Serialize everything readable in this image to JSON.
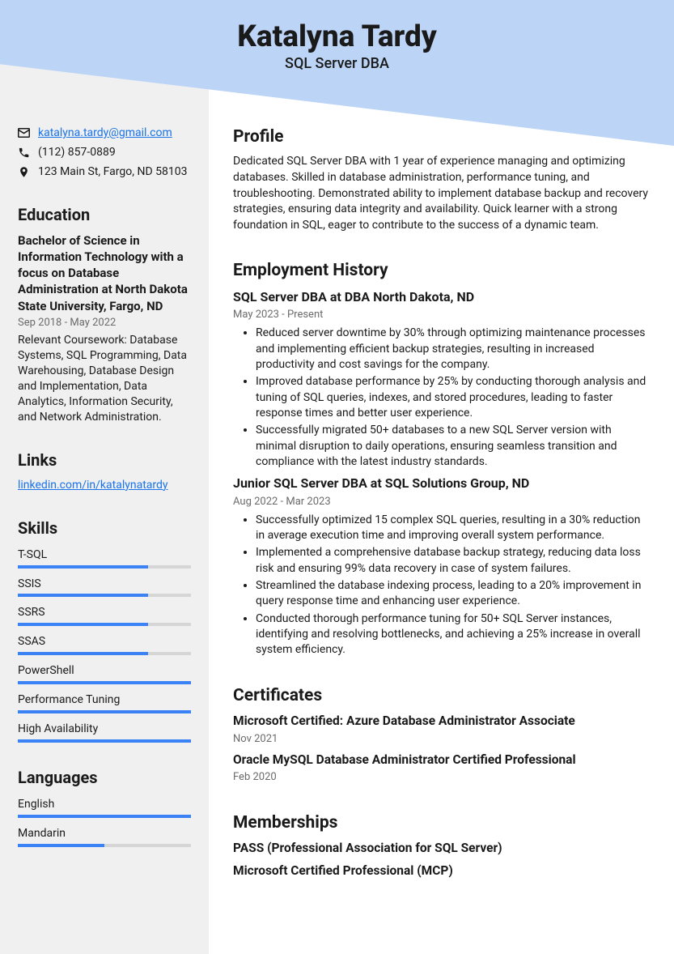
{
  "header": {
    "name": "Katalyna Tardy",
    "title": "SQL Server DBA"
  },
  "contact": {
    "email": "katalyna.tardy@gmail.com",
    "phone": "(112) 857-0889",
    "address": "123 Main St, Fargo, ND 58103"
  },
  "education": {
    "heading": "Education",
    "degree": "Bachelor of Science in Information Technology with a focus on Database Administration at North Dakota State University, Fargo, ND",
    "dates": "Sep 2018 - May 2022",
    "courses": "Relevant Coursework: Database Systems, SQL Programming, Data Warehousing, Database Design and Implementation, Data Analytics, Information Security, and Network Administration."
  },
  "links": {
    "heading": "Links",
    "items": [
      "linkedin.com/in/katalynatardy"
    ]
  },
  "skills": {
    "heading": "Skills",
    "items": [
      {
        "name": "T-SQL",
        "pct": 75
      },
      {
        "name": "SSIS",
        "pct": 75
      },
      {
        "name": "SSRS",
        "pct": 75
      },
      {
        "name": "SSAS",
        "pct": 75
      },
      {
        "name": "PowerShell",
        "pct": 100
      },
      {
        "name": "Performance Tuning",
        "pct": 100
      },
      {
        "name": "High Availability",
        "pct": 100
      }
    ]
  },
  "languages": {
    "heading": "Languages",
    "items": [
      {
        "name": "English",
        "pct": 100
      },
      {
        "name": "Mandarin",
        "pct": 50
      }
    ]
  },
  "profile": {
    "heading": "Profile",
    "text": "Dedicated SQL Server DBA with 1 year of experience managing and optimizing databases. Skilled in database administration, performance tuning, and troubleshooting. Demonstrated ability to implement database backup and recovery strategies, ensuring data integrity and availability. Quick learner with a strong foundation in SQL, eager to contribute to the success of a dynamic team."
  },
  "employment": {
    "heading": "Employment History",
    "jobs": [
      {
        "title": "SQL Server DBA at DBA North Dakota, ND",
        "dates": "May 2023 - Present",
        "bullets": [
          "Reduced server downtime by 30% through optimizing maintenance processes and implementing efficient backup strategies, resulting in increased productivity and cost savings for the company.",
          "Improved database performance by 25% by conducting thorough analysis and tuning of SQL queries, indexes, and stored procedures, leading to faster response times and better user experience.",
          "Successfully migrated 50+ databases to a new SQL Server version with minimal disruption to daily operations, ensuring seamless transition and compliance with the latest industry standards."
        ]
      },
      {
        "title": "Junior SQL Server DBA at SQL Solutions Group, ND",
        "dates": "Aug 2022 - Mar 2023",
        "bullets": [
          "Successfully optimized 15 complex SQL queries, resulting in a 30% reduction in average execution time and improving overall system performance.",
          "Implemented a comprehensive database backup strategy, reducing data loss risk and ensuring 99% data recovery in case of system failures.",
          "Streamlined the database indexing process, leading to a 20% improvement in query response time and enhancing user experience.",
          "Conducted thorough performance tuning for 50+ SQL Server instances, identifying and resolving bottlenecks, and achieving a 25% increase in overall system efficiency."
        ]
      }
    ]
  },
  "certificates": {
    "heading": "Certificates",
    "items": [
      {
        "title": "Microsoft Certified: Azure Database Administrator Associate",
        "date": "Nov 2021"
      },
      {
        "title": "Oracle MySQL Database Administrator Certified Professional",
        "date": "Feb 2020"
      }
    ]
  },
  "memberships": {
    "heading": "Memberships",
    "items": [
      "PASS (Professional Association for SQL Server)",
      "Microsoft Certified Professional (MCP)"
    ]
  }
}
